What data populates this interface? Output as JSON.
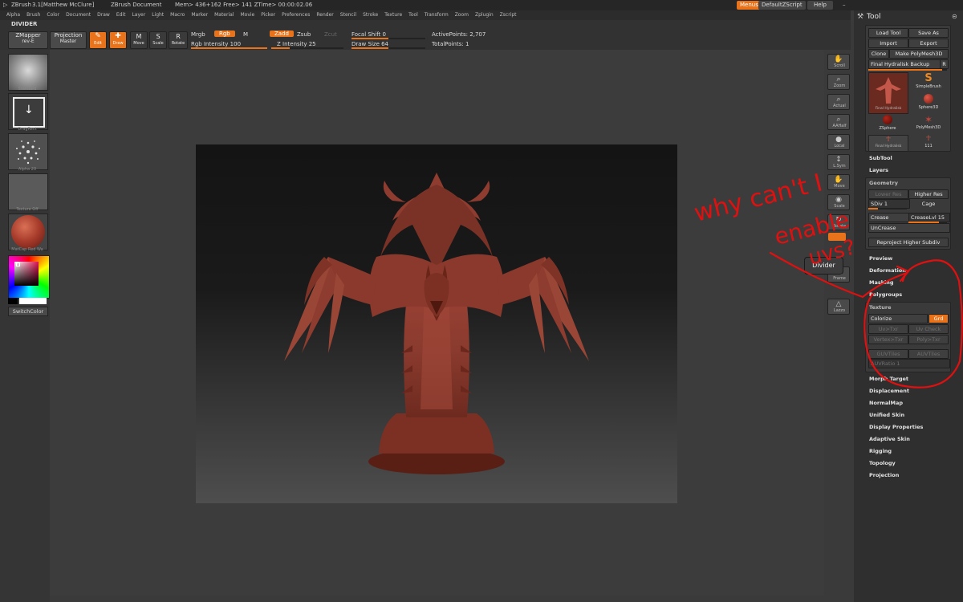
{
  "titlebar": {
    "app": "ZBrush",
    "version": "3.1[Matthew McClure]",
    "doc": "ZBrush Document",
    "mem": "Mem> 436+162  Free> 141  ZTime> 00:00:02.06",
    "menus_btn": "Menus",
    "script_btn": "DefaultZScript",
    "help_btn": "Help"
  },
  "menubar": [
    "Alpha",
    "Brush",
    "Color",
    "Document",
    "Draw",
    "Edit",
    "Layer",
    "Light",
    "Macro",
    "Marker",
    "Material",
    "Movie",
    "Picker",
    "Preferences",
    "Render",
    "Stencil",
    "Stroke",
    "Texture",
    "Tool",
    "Transform",
    "Zoom",
    "Zplugin",
    "Zscript"
  ],
  "section_label": "DIVIDER",
  "toolbar": {
    "zmapper": "ZMapper",
    "zmapper_sub": "rev-E",
    "projection": "Projection",
    "projection_sub": "Master",
    "edit": "Edit",
    "draw": "Draw",
    "move": "Move",
    "scale": "Scale",
    "rotate": "Rotate",
    "mrgb": "Mrgb",
    "rgb": "Rgb",
    "m": "M",
    "rgb_intensity": "Rgb Intensity 100",
    "zadd": "Zadd",
    "zsub": "Zsub",
    "zcut": "Zcut",
    "z_intensity": "Z Intensity 25",
    "focal_shift": "Focal Shift 0",
    "draw_size": "Draw Size 64",
    "active_points": "ActivePoints: 2,707",
    "total_points": "TotalPoints: 1"
  },
  "leftshelf": {
    "brush": "Standard",
    "stroke": "DragRect",
    "alpha": "Alpha 23",
    "texture": "Texture Off",
    "material": "MatCap Red Wa",
    "switch": "SwitchColor"
  },
  "rightshelf": [
    "Scroll",
    "Zoom",
    "Actual",
    "AAHalf",
    "Local",
    "L.Sym",
    "Move",
    "Scale",
    "Rotate",
    "Frame",
    "Lazzo"
  ],
  "tooltip": "Divider",
  "tool": {
    "title": "Tool",
    "buttons": [
      "Load Tool",
      "Save As",
      "Import",
      "Export",
      "Clone",
      "Make PolyMesh3D"
    ],
    "current": "Final Hydralisk Backup",
    "r": "R",
    "thumbs": [
      "Final Hydralisk",
      "SimpleBrush",
      "Sphere3D",
      "ZSphere",
      "PolyMesh3D",
      "Final Hydralisk",
      "111"
    ],
    "subtool": "SubTool",
    "layers": "Layers",
    "geometry": "Geometry",
    "lower_res": "Lower Res",
    "higher_res": "Higher Res",
    "sdiv": "SDiv 1",
    "cage": "Cage",
    "crease": "Crease",
    "crease_lvl": "CreaseLvl 15",
    "uncrease": "UnCrease",
    "reproject": "Reproject Higher Subdiv",
    "preview": "Preview",
    "deformation": "Deformation",
    "masking": "Masking",
    "polygroups": "Polygroups",
    "texture": "Texture",
    "colorize": "Colorize",
    "grd": "Grd",
    "uv_btns": [
      "Uv>Txr",
      "Uv Check",
      "Vertex>Txr",
      "Poly>Txr",
      "GUVTiles",
      "AUVTiles"
    ],
    "auv_ratio": "AUVRatio 1",
    "rest": [
      "Morph Target",
      "Displacement",
      "NormalMap",
      "Unified Skin",
      "Display Properties",
      "Adaptive Skin",
      "Rigging",
      "Topology",
      "Projection"
    ]
  },
  "annotation": [
    "why can't I",
    "enable",
    "uvs?"
  ]
}
